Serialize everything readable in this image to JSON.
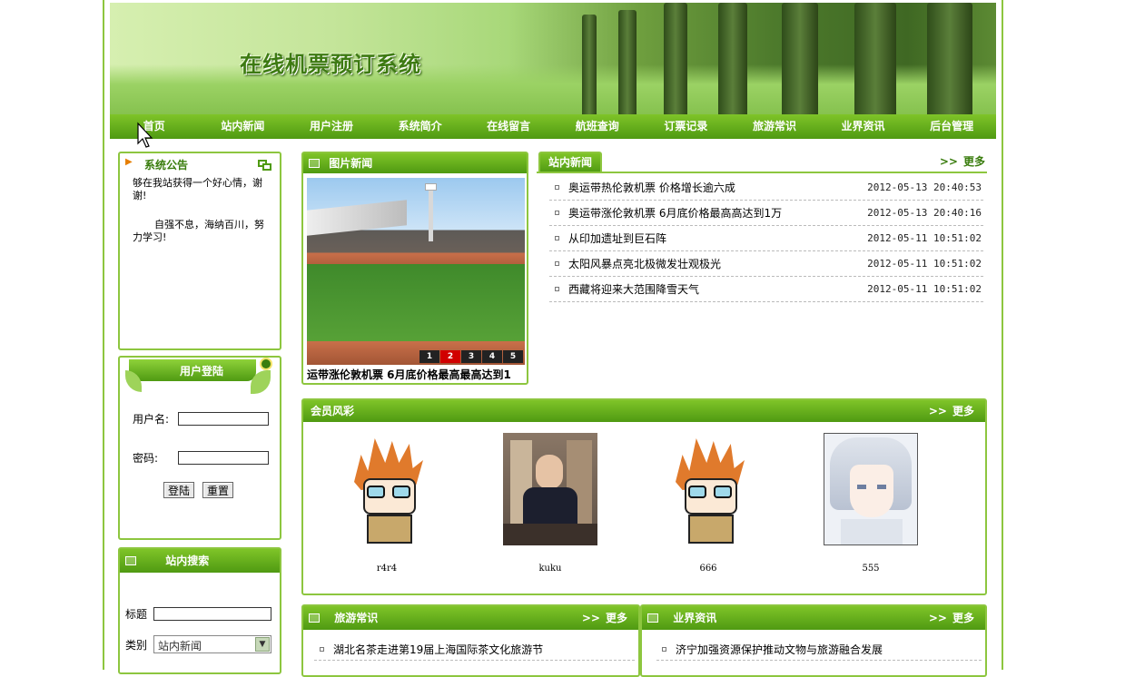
{
  "site_title": "在线机票预订系统",
  "nav": [
    "首页",
    "站内新闻",
    "用户注册",
    "系统简介",
    "在线留言",
    "航班查询",
    "订票记录",
    "旅游常识",
    "业界资讯",
    "后台管理"
  ],
  "notice": {
    "title": "系统公告",
    "lines": [
      "够在我站获得一个好心情，谢谢!",
      "自强不息，海纳百川，努力学习!"
    ]
  },
  "login": {
    "title": "用户登陆",
    "username_label": "用户名:",
    "password_label": "密码:",
    "login_button": "登陆",
    "reset_button": "重置"
  },
  "search": {
    "title": "站内搜索",
    "title_label": "标题",
    "category_label": "类别",
    "category_selected": "站内新闻"
  },
  "photo_news": {
    "title": "图片新闻",
    "caption": "运带涨伦敦机票 6月底价格最高最高达到1",
    "slides": [
      "1",
      "2",
      "3",
      "4",
      "5"
    ],
    "active_slide": "2"
  },
  "site_news": {
    "title": "站内新闻",
    "more": "更多",
    "items": [
      {
        "title": "奥运带热伦敦机票 价格增长逾六成",
        "date": "2012-05-13 20:40:53"
      },
      {
        "title": "奥运带涨伦敦机票 6月底价格最高高达到1万",
        "date": "2012-05-13 20:40:16"
      },
      {
        "title": "从印加遗址到巨石阵",
        "date": "2012-05-11 10:51:02"
      },
      {
        "title": "太阳风暴点亮北极微发壮观极光",
        "date": "2012-05-11 10:51:02"
      },
      {
        "title": "西藏将迎来大范围降雪天气",
        "date": "2012-05-11 10:51:02"
      }
    ]
  },
  "members": {
    "title": "会员风彩",
    "more": "更多",
    "items": [
      {
        "name": "r4r4"
      },
      {
        "name": "kuku"
      },
      {
        "name": "666"
      },
      {
        "name": "555"
      }
    ]
  },
  "travel": {
    "title": "旅游常识",
    "more": "更多",
    "items": [
      "湖北名茶走进第19届上海国际茶文化旅游节"
    ]
  },
  "industry": {
    "title": "业界资讯",
    "more": "更多",
    "items": [
      "济宁加强资源保护推动文物与旅游融合发展"
    ]
  }
}
